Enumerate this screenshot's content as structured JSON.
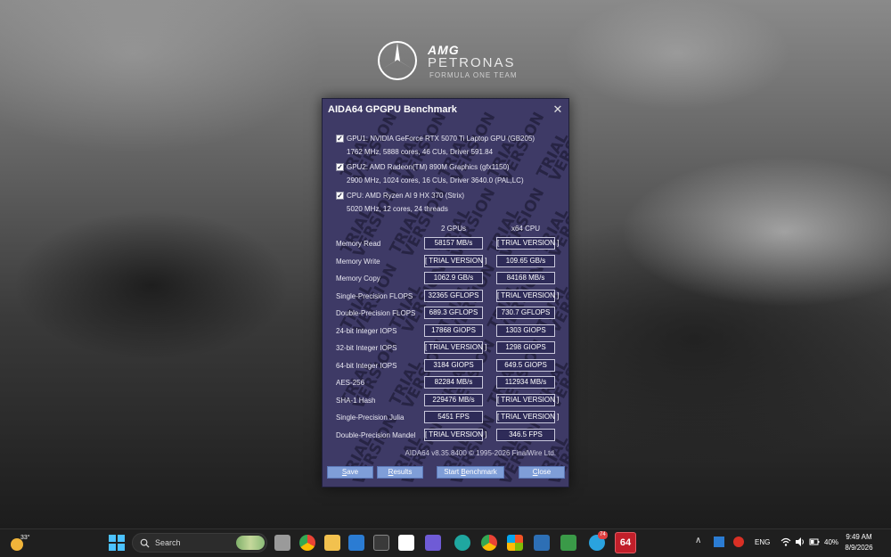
{
  "brand": {
    "amg": "AMG",
    "petronas": "PETRONAS",
    "team": "FORMULA ONE TEAM"
  },
  "window": {
    "title": "AIDA64 GPGPU Benchmark",
    "close_glyph": "✕",
    "watermark_words": [
      "TRIAL",
      "VERSION"
    ]
  },
  "devices": [
    {
      "checked": true,
      "name": "GPU1: NVIDIA GeForce RTX 5070 Ti Laptop GPU (GB205)",
      "details": "1762 MHz, 5888 cores, 46 CUs, Driver 591.84"
    },
    {
      "checked": true,
      "name": "GPU2: AMD Radeon(TM) 890M Graphics (gfx1150)",
      "details": "2900 MHz, 1024 cores, 16 CUs, Driver 3640.0 (PAL,LC)"
    },
    {
      "checked": true,
      "name": "CPU: AMD Ryzen AI 9 HX 370 (Strix)",
      "details": "5020 MHz, 12 cores, 24 threads"
    }
  ],
  "columns": {
    "gpus": "2 GPUs",
    "cpu": "x64 CPU"
  },
  "results": [
    {
      "label": "Memory Read",
      "gpus": "58157 MB/s",
      "cpu": "[ TRIAL VERSION ]"
    },
    {
      "label": "Memory Write",
      "gpus": "[ TRIAL VERSION ]",
      "cpu": "109.65 GB/s"
    },
    {
      "label": "Memory Copy",
      "gpus": "1062.9 GB/s",
      "cpu": "84168 MB/s"
    },
    {
      "label": "Single-Precision FLOPS",
      "gpus": "32365 GFLOPS",
      "cpu": "[ TRIAL VERSION ]"
    },
    {
      "label": "Double-Precision FLOPS",
      "gpus": "689.3 GFLOPS",
      "cpu": "730.7 GFLOPS"
    },
    {
      "label": "24-bit Integer IOPS",
      "gpus": "17868 GIOPS",
      "cpu": "1303 GIOPS"
    },
    {
      "label": "32-bit Integer IOPS",
      "gpus": "[ TRIAL VERSION ]",
      "cpu": "1298 GIOPS"
    },
    {
      "label": "64-bit Integer IOPS",
      "gpus": "3184 GIOPS",
      "cpu": "649.5 GIOPS"
    },
    {
      "label": "AES-256",
      "gpus": "82284 MB/s",
      "cpu": "112934 MB/s"
    },
    {
      "label": "SHA-1 Hash",
      "gpus": "229476 MB/s",
      "cpu": "[ TRIAL VERSION ]"
    },
    {
      "label": "Single-Precision Julia",
      "gpus": "5451 FPS",
      "cpu": "[ TRIAL VERSION ]"
    },
    {
      "label": "Double-Precision Mandel",
      "gpus": "[ TRIAL VERSION ]",
      "cpu": "346.5 FPS"
    }
  ],
  "footer": "AIDA64 v8.35.8400 © 1995-2026 FinalWire Ltd.",
  "buttons": {
    "save": {
      "mnemonic": "S",
      "rest": "ave"
    },
    "results": {
      "mnemonic": "R",
      "rest": "esults"
    },
    "start": {
      "pre": "Start ",
      "mnemonic": "B",
      "rest": "enchmark"
    },
    "close": {
      "mnemonic": "C",
      "rest": "lose"
    }
  },
  "taskbar": {
    "weather_temp": "33°",
    "search_placeholder": "Search",
    "pinned_icons": [
      "task-view-icon",
      "chrome-icon",
      "file-explorer-icon",
      "outlook-calendar-icon",
      "terminal-icon",
      "arc-icon",
      "obsidian-icon",
      "edge-icon",
      "chrome-beta-icon",
      "microsoft-store-icon",
      "aida64-sensor-icon",
      "phone-link-icon",
      "telegram-icon",
      "aida64-icon"
    ],
    "telegram_badge": "74",
    "aida_label": "64",
    "language": "ENG",
    "battery_percent": "40%",
    "time": "9:49 AM",
    "date": "8/9/2026"
  },
  "colors": {
    "window_bg": "#3e3a66",
    "value_box_bg": "#2e2b58",
    "button_bg": "#7f9ed8",
    "taskbar_bg": "#1f1f1f"
  }
}
